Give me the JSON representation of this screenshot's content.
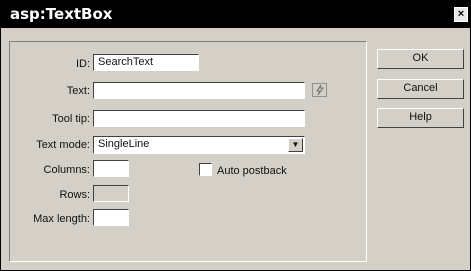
{
  "window": {
    "title": "asp:TextBox",
    "close_glyph": "×"
  },
  "form": {
    "id": {
      "label": "ID:",
      "value": "SearchText"
    },
    "text": {
      "label": "Text:",
      "value": "",
      "picker_icon": "lightning-icon"
    },
    "tooltip": {
      "label": "Tool tip:",
      "value": ""
    },
    "text_mode": {
      "label": "Text mode:",
      "value": "SingleLine"
    },
    "columns": {
      "label": "Columns:",
      "value": ""
    },
    "rows": {
      "label": "Rows:",
      "value": ""
    },
    "max_length": {
      "label": "Max length:",
      "value": ""
    },
    "auto_postback": {
      "label": "Auto postback",
      "checked": false
    }
  },
  "buttons": {
    "ok": "OK",
    "cancel": "Cancel",
    "help": "Help"
  }
}
